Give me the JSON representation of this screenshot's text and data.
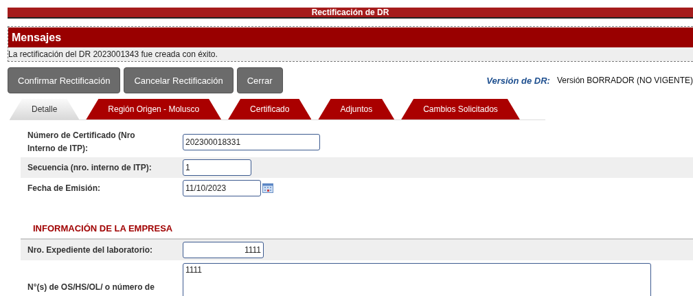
{
  "header": {
    "title": "Rectificación de DR"
  },
  "messages": {
    "title": "Mensajes",
    "items": [
      "La rectificación del DR 2023001343 fue creada con éxito."
    ]
  },
  "buttons": [
    "Confirmar Rectificación",
    "Cancelar Rectificación",
    "Cerrar"
  ],
  "version": {
    "label": "Versión de DR:",
    "value": "Versión BORRADOR (NO VIGENTE)"
  },
  "tabs": [
    {
      "label": "Detalle",
      "selected": true
    },
    {
      "label": "Región Origen - Molusco",
      "selected": false
    },
    {
      "label": "Certificado",
      "selected": false
    },
    {
      "label": "Adjuntos",
      "selected": false
    },
    {
      "label": "Cambios Solicitados",
      "selected": false
    }
  ],
  "sections": [
    {
      "rows": [
        {
          "label": "Número de Certificado (Nro Interno de ITP):",
          "value": "202300018331",
          "kind": "text"
        },
        {
          "label": "Secuencia (nro. interno de ITP):",
          "value": "1",
          "kind": "text"
        },
        {
          "label": "Fecha de Emisión:",
          "value": "11/10/2023",
          "kind": "date"
        }
      ]
    },
    {
      "title": "INFORMACIÓN DE LA EMPRESA",
      "rows": [
        {
          "label": "Nro. Expediente del laboratorio:",
          "value": "1111",
          "kind": "number"
        },
        {
          "label": "N°(s) de OS/HS/OL/ o número de",
          "value": "1111",
          "kind": "textarea"
        }
      ]
    }
  ]
}
